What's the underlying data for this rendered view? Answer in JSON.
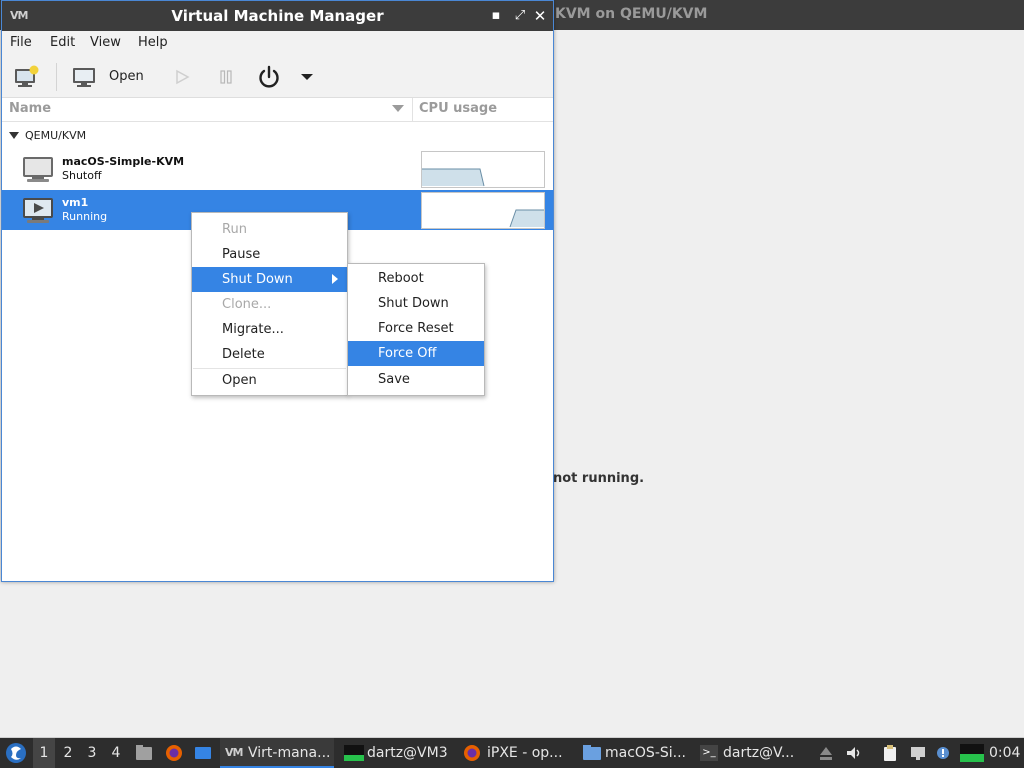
{
  "background_window": {
    "title": "KVM on QEMU/KVM",
    "message": "not running."
  },
  "window": {
    "title": "Virtual Machine Manager",
    "controls": {
      "minimize": "▪",
      "maximize": "⤢",
      "close": "✕"
    }
  },
  "menubar": {
    "items": [
      "File",
      "Edit",
      "View",
      "Help"
    ]
  },
  "toolbar": {
    "open_label": "Open",
    "icons": [
      "new-vm-icon",
      "monitor-icon",
      "play-icon",
      "pause-icon",
      "power-icon",
      "dropdown-arrow-icon"
    ]
  },
  "list": {
    "columns": {
      "name": "Name",
      "cpu": "CPU usage"
    },
    "group": "QEMU/KVM",
    "vms": [
      {
        "name": "macOS-Simple-KVM",
        "status": "Shutoff",
        "selected": false
      },
      {
        "name": "vm1",
        "status": "Running",
        "selected": true
      }
    ]
  },
  "context_menu": {
    "items": [
      {
        "label": "Run",
        "disabled": true
      },
      {
        "label": "Pause",
        "disabled": false
      },
      {
        "label": "Shut Down",
        "disabled": false,
        "active": true,
        "submenu": true
      },
      {
        "label": "Clone...",
        "disabled": true
      },
      {
        "label": "Migrate...",
        "disabled": false
      },
      {
        "label": "Delete",
        "disabled": false
      },
      {
        "label": "Open",
        "disabled": false
      }
    ]
  },
  "submenu": {
    "items": [
      {
        "label": "Reboot"
      },
      {
        "label": "Shut Down"
      },
      {
        "label": "Force Reset"
      },
      {
        "label": "Force Off",
        "active": true
      },
      {
        "label": "Save"
      }
    ]
  },
  "taskbar": {
    "workspaces": [
      "1",
      "2",
      "3",
      "4"
    ],
    "active_workspace": "1",
    "tasks": [
      "Virt-mana...",
      "dartz@VM3",
      "iPXE - op...",
      "macOS-Si...",
      "dartz@V..."
    ],
    "clock": "0:04"
  },
  "colors": {
    "accent": "#3584e4",
    "titlebar": "#3c3c3c",
    "taskbar": "#2d2d2d"
  }
}
